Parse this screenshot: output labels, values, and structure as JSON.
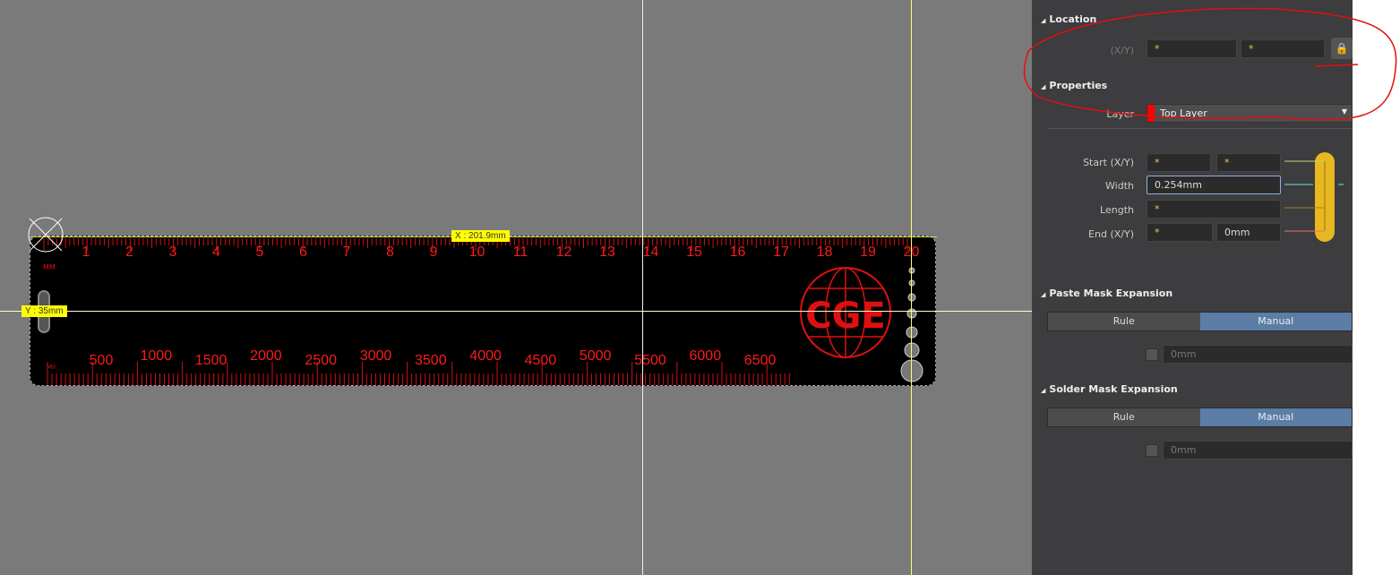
{
  "canvas": {
    "x_readout": "X : 201.9mm",
    "y_readout": "Y : 35mm",
    "top_ruler_labels": [
      "1",
      "2",
      "3",
      "4",
      "5",
      "6",
      "7",
      "8",
      "9",
      "10",
      "11",
      "12",
      "13",
      "14",
      "15",
      "16",
      "17",
      "18",
      "19",
      "20"
    ],
    "bottom_ruler_labels": [
      "500",
      "1000",
      "1500",
      "2000",
      "2500",
      "3000",
      "3500",
      "4000",
      "4500",
      "5000",
      "5500",
      "6000",
      "6500"
    ],
    "top_unit": "MM",
    "bottom_unit": "Mil",
    "logo_text": "CGE",
    "colors": {
      "copper": "#ff1a1a",
      "crosshair": "#ffff66",
      "board": "#000000"
    }
  },
  "panel": {
    "location": {
      "title": "Location",
      "xy_label": "(X/Y)",
      "x": "*",
      "y": "*",
      "lock_icon": "lock-icon"
    },
    "properties": {
      "title": "Properties",
      "layer_label": "Layer",
      "layer_value": "Top Layer",
      "layer_color": "#ff0000",
      "start_label": "Start (X/Y)",
      "start_x": "*",
      "start_y": "*",
      "width_label": "Width",
      "width_value": "0.254mm",
      "length_label": "Length",
      "length_value": "*",
      "end_label": "End (X/Y)",
      "end_x": "*",
      "end_y": "0mm"
    },
    "paste": {
      "title": "Paste Mask Expansion",
      "rule": "Rule",
      "manual": "Manual",
      "value": "0mm"
    },
    "solder": {
      "title": "Solder Mask Expansion",
      "rule": "Rule",
      "manual": "Manual",
      "value": "0mm"
    }
  }
}
